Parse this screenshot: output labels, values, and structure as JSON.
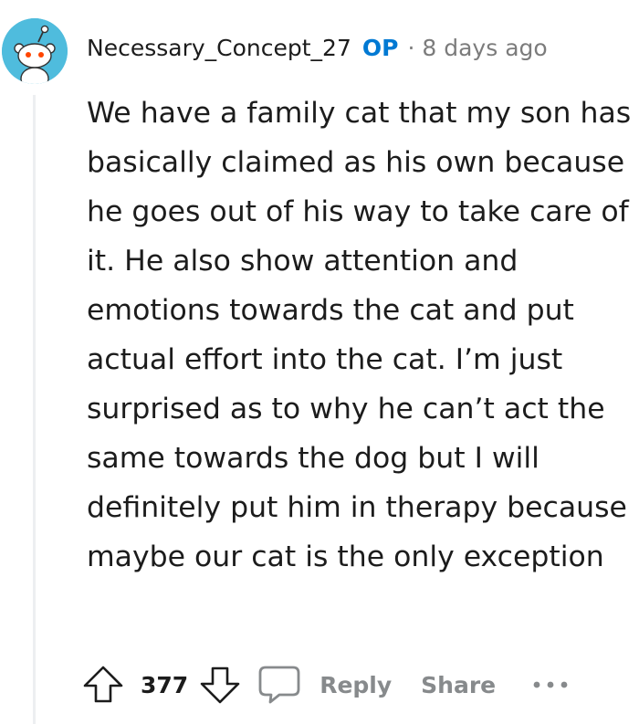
{
  "comment": {
    "author": "Necessary_Concept_27",
    "op_badge": "OP",
    "separator": "·",
    "timestamp": "8 days ago",
    "body": "We have a family cat that my son has basically claimed as his own because he goes out of his way to take care of it. He also show attention and emotions towards the cat and put actual effort into the cat. I’m just surprised as to why he can’t act the same towards the dog but I will definitely put him in therapy because maybe our cat is the only exception",
    "vote_count": "377",
    "actions": {
      "reply_label": "Reply",
      "share_label": "Share",
      "more_label": "•••"
    }
  },
  "icons": {
    "avatar": "snoo-avatar-icon",
    "upvote": "upvote-arrow-icon",
    "downvote": "downvote-arrow-icon",
    "reply": "speech-bubble-icon",
    "more": "more-options-icon"
  },
  "colors": {
    "avatar_bg": "#4fbcdd",
    "op_badge": "#0079d3",
    "muted": "#7c7c7c",
    "action_gray": "#878a8c",
    "thread_line": "#edeff1",
    "text": "#1c1c1c"
  }
}
